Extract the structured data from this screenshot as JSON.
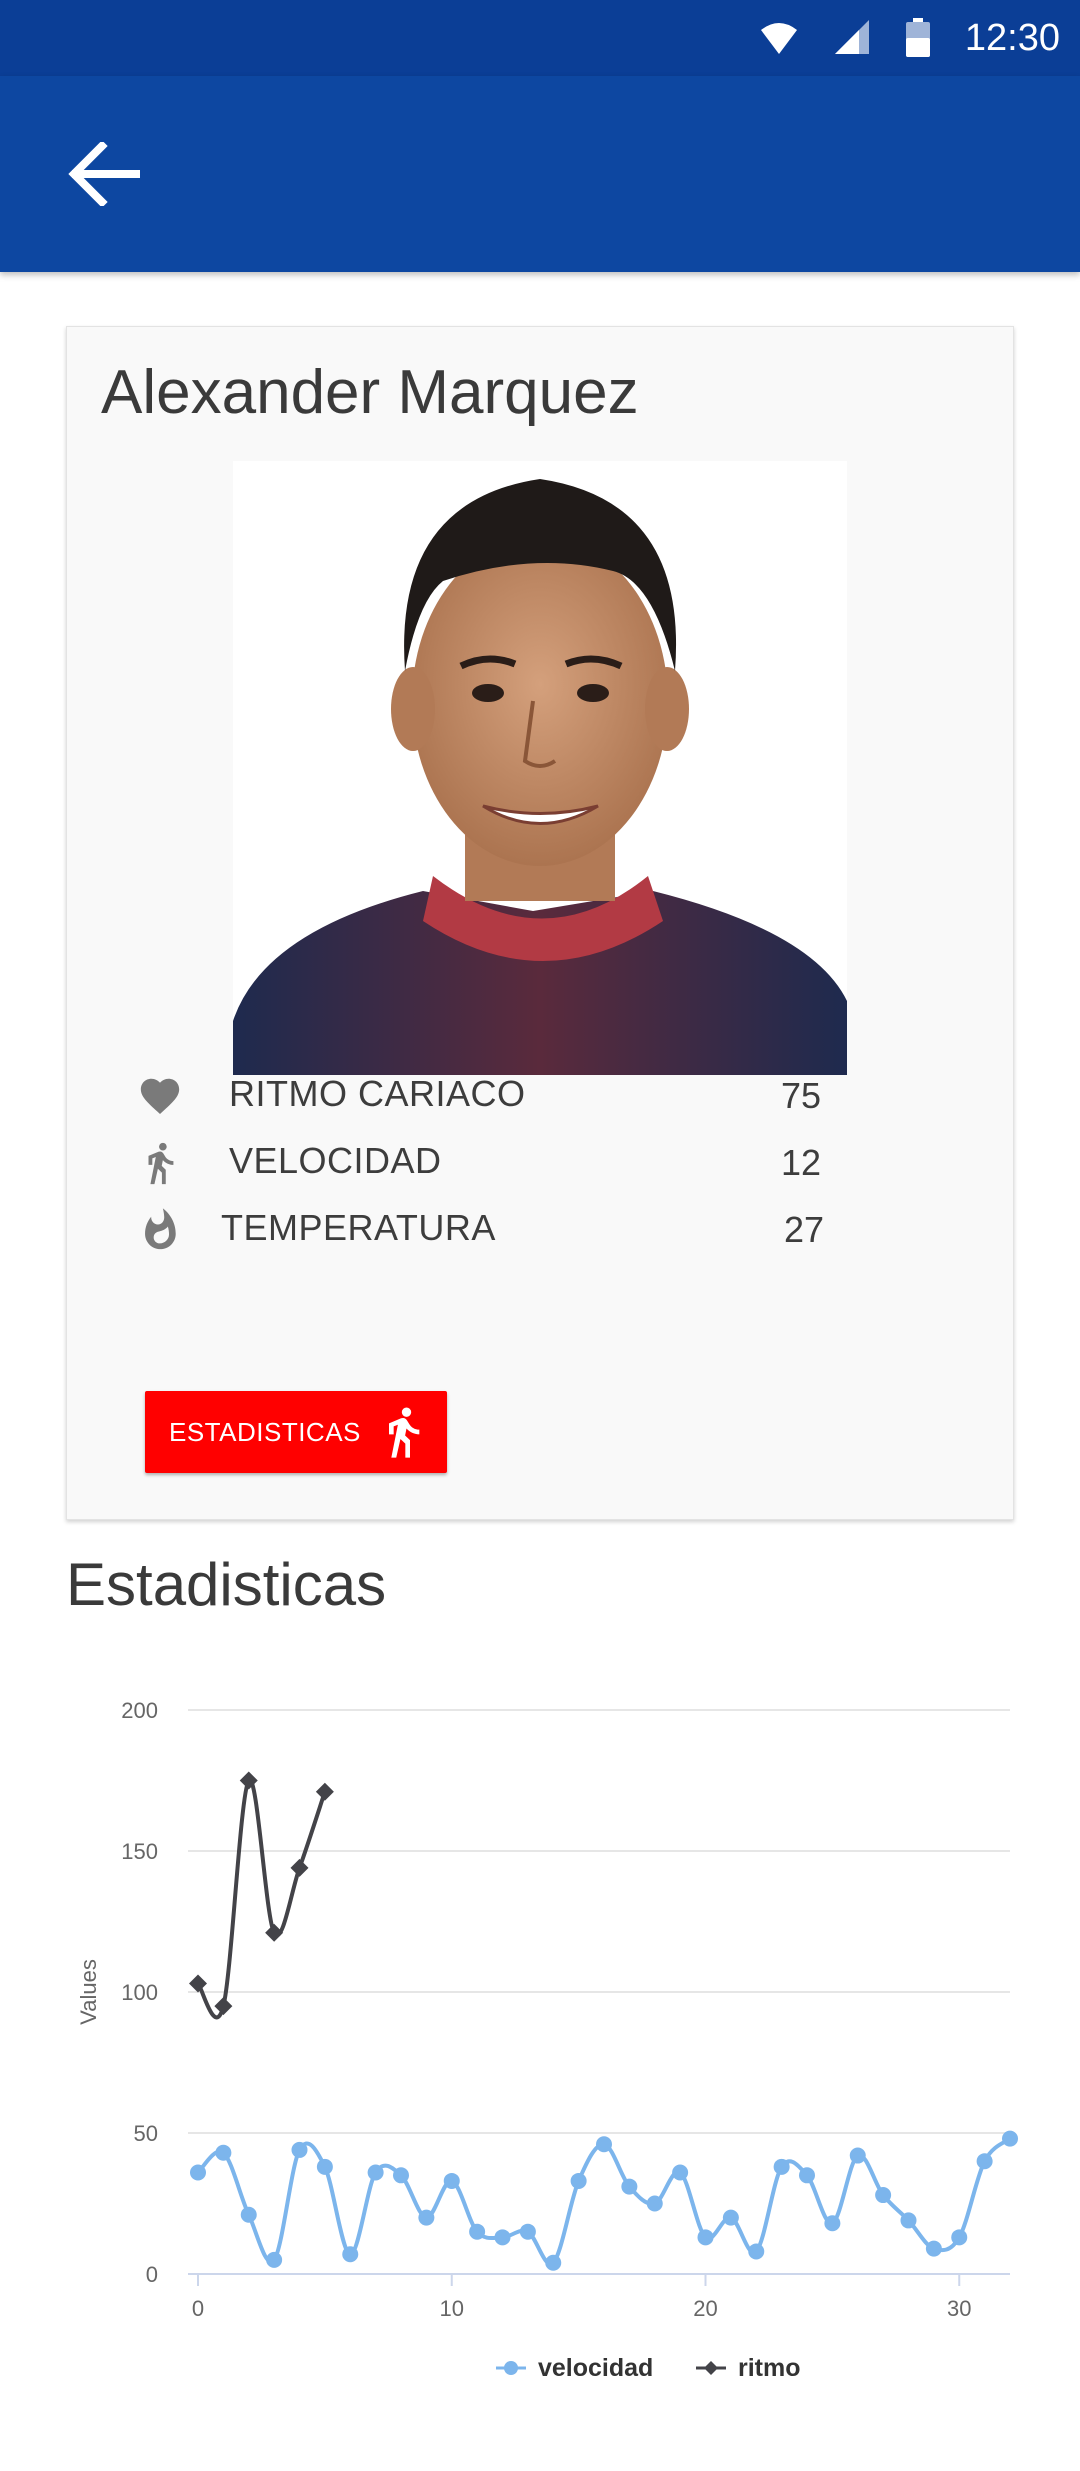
{
  "status_bar": {
    "time": "12:30",
    "icons": [
      "wifi-icon",
      "cell-signal-icon",
      "battery-icon"
    ]
  },
  "app_bar": {
    "back_icon": "arrow-back-icon"
  },
  "profile": {
    "name": "Alexander Marquez",
    "photo": "player-portrait"
  },
  "stats": [
    {
      "icon": "heart-icon",
      "label": "RITMO CARIACO",
      "value": "75"
    },
    {
      "icon": "run-icon",
      "label": "VELOCIDAD",
      "value": "12"
    },
    {
      "icon": "flame-icon",
      "label": "TEMPERATURA",
      "value": "27"
    }
  ],
  "button": {
    "label": "ESTADISTICAS",
    "icon": "run-icon"
  },
  "section": {
    "title": "Estadisticas"
  },
  "colors": {
    "status_bar": "#0b3e96",
    "app_bar": "#0d47a1",
    "button": "#ff0000",
    "velocidad": "#7cb5ec",
    "ritmo": "#434348"
  },
  "chart_data": {
    "type": "line",
    "ylabel": "Values",
    "xlabel": "",
    "ylim": [
      0,
      200
    ],
    "xlim": [
      0,
      32
    ],
    "yticks": [
      0,
      50,
      100,
      150,
      200
    ],
    "xticks": [
      0,
      10,
      20,
      30
    ],
    "grid": true,
    "legend": "bottom-center",
    "series": [
      {
        "name": "velocidad",
        "marker": "circle",
        "x": [
          0,
          1,
          2,
          3,
          4,
          5,
          6,
          7,
          8,
          9,
          10,
          11,
          12,
          13,
          14,
          15,
          16,
          17,
          18,
          19,
          20,
          21,
          22,
          23,
          24,
          25,
          26,
          27,
          28,
          29,
          30,
          31,
          32
        ],
        "values": [
          36,
          43,
          21,
          5,
          44,
          38,
          7,
          36,
          35,
          20,
          33,
          15,
          13,
          15,
          4,
          33,
          46,
          31,
          25,
          36,
          13,
          20,
          8,
          38,
          35,
          18,
          42,
          28,
          19,
          9,
          13,
          40,
          48
        ]
      },
      {
        "name": "ritmo",
        "marker": "diamond",
        "x": [
          0,
          1,
          2,
          3,
          4,
          5
        ],
        "values": [
          103,
          95,
          175,
          121,
          144,
          171
        ]
      }
    ]
  }
}
